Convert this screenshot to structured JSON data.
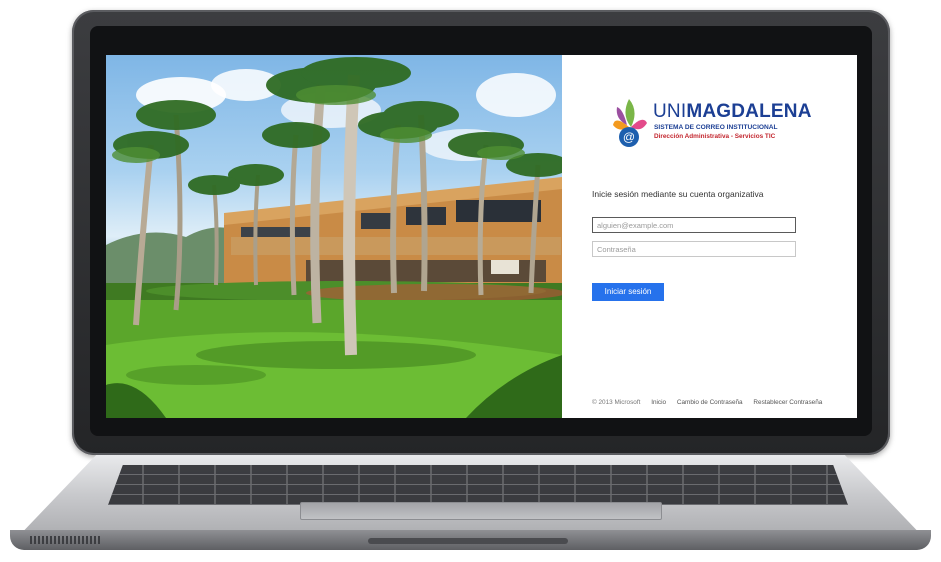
{
  "brand": {
    "name_light": "UNI",
    "name_bold": "MAGDALENA",
    "subtitle": "SISTEMA DE CORREO INSTITUCIONAL",
    "department": "Dirección Administrativa - Servicios TIC",
    "colors": {
      "primary": "#1c3f94",
      "accent": "#c3272f"
    }
  },
  "login": {
    "prompt": "Inicie sesión mediante su cuenta organizativa",
    "username": {
      "value": "",
      "placeholder": "alguien@example.com"
    },
    "password": {
      "value": "",
      "placeholder": "Contraseña"
    },
    "submit_label": "Iniciar sesión",
    "accent_color": "#2672ec"
  },
  "footer": {
    "copyright": "© 2013 Microsoft",
    "links": [
      "Inicio",
      "Cambio de Contraseña",
      "Restablecer Contraseña"
    ]
  },
  "background_image": "campus building with palm trees and lawn"
}
